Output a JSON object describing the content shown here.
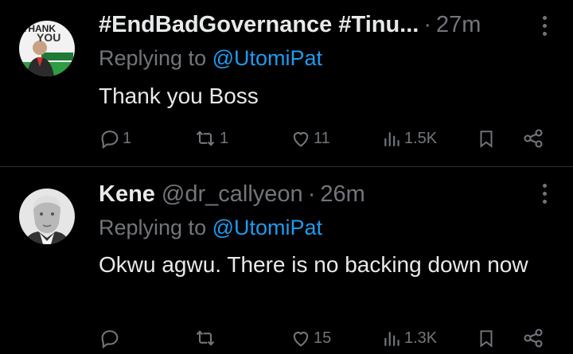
{
  "tweets": [
    {
      "name": "#EndBadGovernance #Tinu...",
      "handle": "",
      "time": "27m",
      "replying_label": "Replying to",
      "replying_to": "@UtomiPat",
      "text": "Thank you Boss",
      "avatar_text": [
        "THANK",
        "YOU"
      ],
      "actions": {
        "replies": "1",
        "reposts": "1",
        "likes": "11",
        "views": "1.5K"
      }
    },
    {
      "name": "Kene",
      "handle": "@dr_callyeon",
      "time": "26m",
      "replying_label": "Replying to",
      "replying_to": "@UtomiPat",
      "text": "Okwu agwu. There is no backing down now",
      "actions": {
        "replies": "",
        "reposts": "",
        "likes": "15",
        "views": "1.3K"
      }
    }
  ],
  "icons": {
    "reply": "reply-icon",
    "repost": "repost-icon",
    "like": "heart-icon",
    "views": "views-icon",
    "bookmark": "bookmark-icon",
    "share": "share-icon",
    "more": "more-icon"
  },
  "colors": {
    "background": "#000000",
    "text": "#e7e9ea",
    "muted": "#71767b",
    "mention": "#1d9bf0",
    "divider": "#2f3336"
  }
}
